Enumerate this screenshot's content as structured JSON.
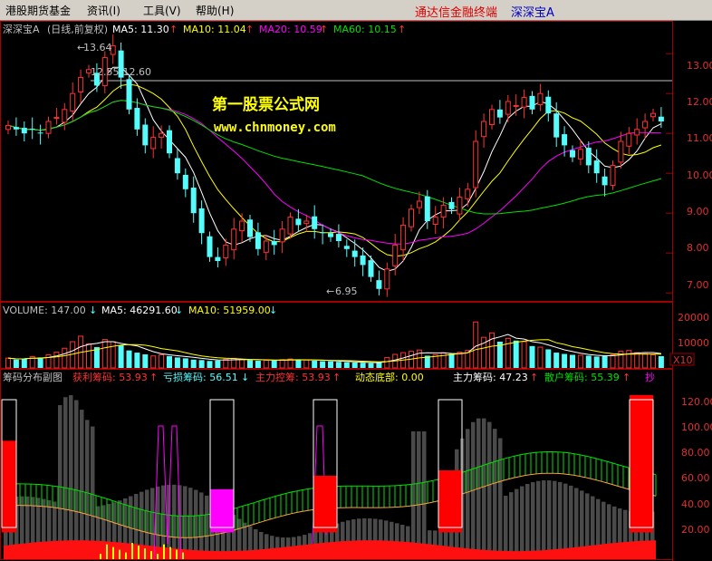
{
  "menu": {
    "items": [
      "港股期货基金",
      "资讯(I)",
      "工具(V)",
      "帮助(H)"
    ],
    "terminal_name": "通达信金融终端",
    "stock_title": "深深宝A"
  },
  "price_panel": {
    "header": {
      "stock": "深深宝A",
      "period": "(日线,前复权)",
      "ma5": "MA5: 11.30",
      "ma10": "MA10: 11.04",
      "ma20": "MA20: 10.59",
      "ma60": "MA60: 10.15"
    },
    "annotations": {
      "high": "13.64",
      "range": "12.55-12.60",
      "low": "6.95"
    },
    "watermark": {
      "line1": "第一股票公式网",
      "line2": "www.chnmoney.com"
    },
    "y_ticks": [
      "13.00",
      "12.00",
      "11.00",
      "10.00",
      "9.00",
      "8.00",
      "7.00"
    ]
  },
  "volume_panel": {
    "header": {
      "volume": "VOLUME: 147.00",
      "ma5": "MA5: 46291.60",
      "ma10": "MA10: 51959.00"
    },
    "y_ticks": [
      "20000",
      "10000"
    ],
    "multiplier": "X10"
  },
  "chip_panel": {
    "header": {
      "title": "筹码分布副图",
      "profit": "获利筹码: 53.93",
      "loss": "亏损筹码: 56.51",
      "main_control": "主力控筹: 53.93",
      "bottom": "动态底部: 0.00",
      "main_chips": "主力筹码: 47.23",
      "retail": "散户筹码: 55.39",
      "extra": "抄"
    },
    "y_ticks": [
      "120.00",
      "100.00",
      "80.00",
      "60.00",
      "40.00",
      "20.00"
    ]
  },
  "colors": {
    "up": "#ff3232",
    "down": "#54fcfc",
    "ma5": "#ffffff",
    "ma10": "#ffff00",
    "ma20": "#ff00ff",
    "ma60": "#00e000",
    "axis": "#a00000",
    "label_red": "#ff3232"
  },
  "chart_data": [
    {
      "type": "candlestick",
      "title": "深深宝A (日线,前复权)",
      "ylim": [
        6.8,
        13.8
      ],
      "closes": [
        11.2,
        11.1,
        11.0,
        11.1,
        11.0,
        11.3,
        11.4,
        11.6,
        12.0,
        12.4,
        12.6,
        12.2,
        12.9,
        13.2,
        12.4,
        11.6,
        11.1,
        10.7,
        10.9,
        11.0,
        10.5,
        10.0,
        9.6,
        9.0,
        8.5,
        7.9,
        7.8,
        8.2,
        8.6,
        8.8,
        8.4,
        8.1,
        8.3,
        8.2,
        8.6,
        8.9,
        8.7,
        8.8,
        8.6,
        8.5,
        8.4,
        8.3,
        8.1,
        7.9,
        7.7,
        7.4,
        7.1,
        7.6,
        8.2,
        8.7,
        9.1,
        9.3,
        8.8,
        8.9,
        9.2,
        9.1,
        9.4,
        9.6,
        10.8,
        11.3,
        11.6,
        11.4,
        11.8,
        11.7,
        11.9,
        11.6,
        12.0,
        11.5,
        10.9,
        10.7,
        10.4,
        10.6,
        10.2,
        10.0,
        9.7,
        10.2,
        10.8,
        11.0,
        11.1,
        11.3,
        11.5,
        11.3
      ],
      "ma_series": [
        {
          "name": "MA5",
          "last": 11.3
        },
        {
          "name": "MA10",
          "last": 11.04
        },
        {
          "name": "MA20",
          "last": 10.59
        },
        {
          "name": "MA60",
          "last": 10.15
        }
      ]
    },
    {
      "type": "bar",
      "title": "VOLUME",
      "ylim": [
        0,
        24000
      ],
      "values": [
        4500,
        3800,
        4200,
        5200,
        4800,
        6000,
        7200,
        9000,
        12000,
        14500,
        11000,
        9500,
        13000,
        12000,
        10500,
        8000,
        7000,
        6200,
        5500,
        6000,
        5400,
        4800,
        4400,
        3800,
        3600,
        3200,
        3400,
        4000,
        4400,
        3900,
        3600,
        3300,
        3500,
        3400,
        3800,
        4100,
        3700,
        3600,
        3300,
        3100,
        3000,
        2800,
        2600,
        2500,
        2400,
        2200,
        2600,
        4800,
        6200,
        7000,
        7600,
        8200,
        5600,
        6000,
        7000,
        6400,
        7200,
        8000,
        21000,
        14000,
        16000,
        12000,
        13500,
        12500,
        12000,
        10000,
        9500,
        8500,
        7000,
        6400,
        6000,
        5800,
        5600,
        5200,
        5400,
        6000,
        7600,
        8000,
        7000,
        6500,
        6000,
        5400
      ]
    },
    {
      "type": "bar",
      "title": "筹码分布副图",
      "ylim": [
        0,
        130
      ],
      "series": [
        {
          "name": "获利筹码",
          "last": 53.93
        },
        {
          "name": "亏损筹码",
          "last": 56.51
        },
        {
          "name": "主力控筹",
          "last": 53.93
        },
        {
          "name": "动态底部",
          "last": 0.0
        },
        {
          "name": "主力筹码",
          "last": 47.23
        },
        {
          "name": "散户筹码",
          "last": 55.39
        }
      ]
    }
  ]
}
